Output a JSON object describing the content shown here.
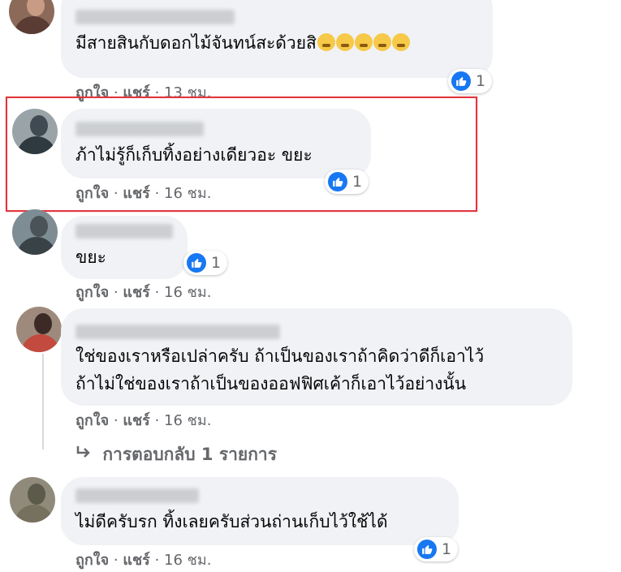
{
  "comments": [
    {
      "text": "มีสายสินกับดอกไม้จันทน์สะด้วยสิ",
      "emoji_count": 5,
      "reaction_count": "1",
      "like": "ถูกใจ",
      "share": "แชร์",
      "time": "13 ชม."
    },
    {
      "text": "ภ้าไม่รู้ก็เก็บทิ้งอย่างเดียวอะ ขยะ",
      "reaction_count": "1",
      "like": "ถูกใจ",
      "share": "แชร์",
      "time": "16 ชม."
    },
    {
      "text": "ขยะ",
      "reaction_count": "1",
      "like": "ถูกใจ",
      "share": "แชร์",
      "time": "16 ชม."
    },
    {
      "text_line1": "ใช่ของเราหรือเปล่าครับ ถ้าเป็นของเราถ้าคิดว่าดีก็เอาไว้",
      "text_line2": "ถ้าไม่ใช่ของเราถ้าเป็นของออฟฟิศเค้าก็เอาไว้อย่างนั้น",
      "like": "ถูกใจ",
      "share": "แชร์",
      "time": "16 ชม.",
      "replies_label": "การตอบกลับ 1 รายการ"
    },
    {
      "text": "ไม่ดีครับรก ทิ้งเลยครับส่วนถ่านเก็บไว้ใช้ได้",
      "reaction_count": "1",
      "like": "ถูกใจ",
      "share": "แชร์",
      "time": "16 ชม."
    }
  ],
  "separator": "·",
  "colors": {
    "bubble": "#f0f2f5",
    "meta_text": "#65676b",
    "like_blue": "#1877f2",
    "highlight_red": "#e2363d"
  },
  "icons": [
    "like-icon",
    "reply-arrow-icon",
    "laughing-emoji-icon"
  ]
}
